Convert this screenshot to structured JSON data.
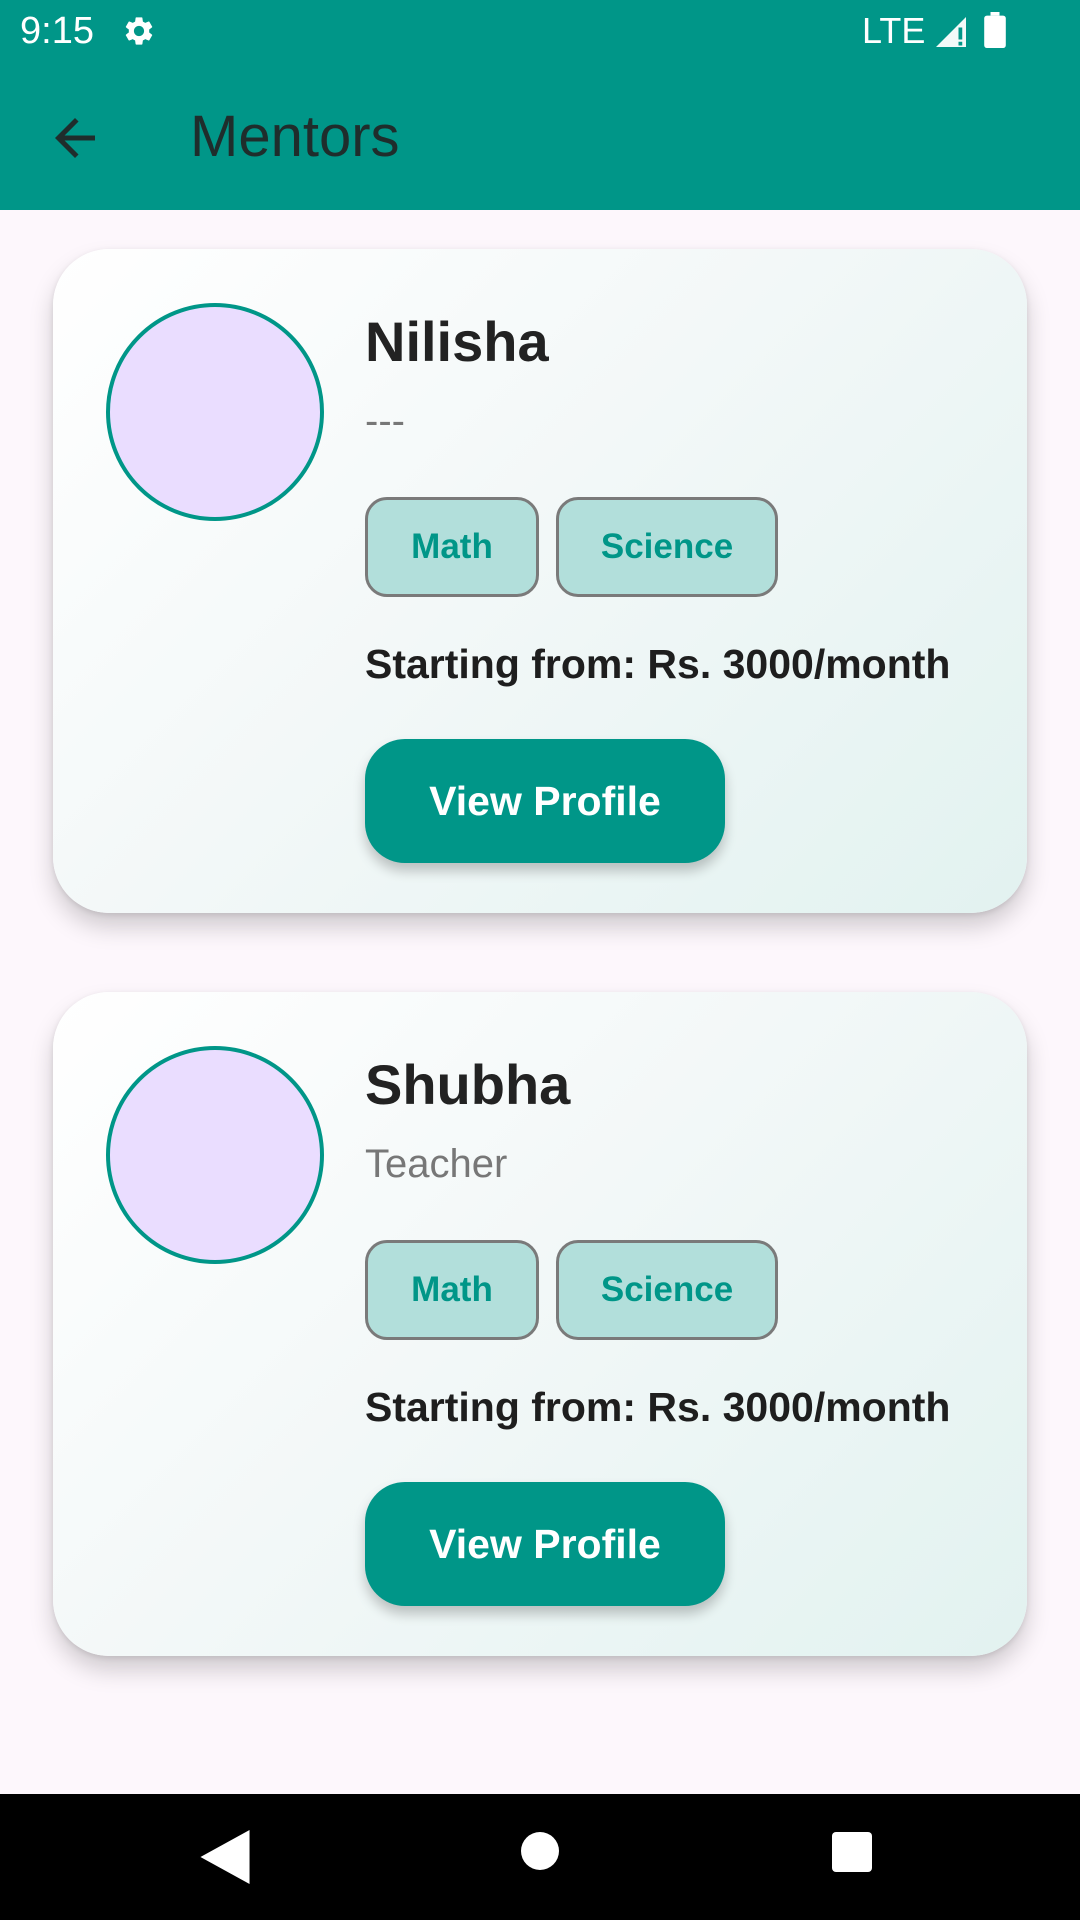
{
  "status_bar": {
    "time": "9:15",
    "network": "LTE",
    "icons": [
      "gear-icon",
      "signal-icon",
      "battery-icon"
    ]
  },
  "app_bar": {
    "title": "Mentors",
    "back_icon": "arrow-left-icon"
  },
  "mentors": [
    {
      "name": "Nilisha",
      "role": "---",
      "subjects": [
        "Math",
        "Science"
      ],
      "price": "Starting from: Rs. 3000/month",
      "button_label": "View Profile"
    },
    {
      "name": "Shubha",
      "role": "Teacher",
      "subjects": [
        "Math",
        "Science"
      ],
      "price": "Starting from: Rs. 3000/month",
      "button_label": "View Profile"
    }
  ],
  "nav_bar": {
    "icons": [
      "nav-back-icon",
      "nav-home-icon",
      "nav-recents-icon"
    ]
  },
  "colors": {
    "primary": "#009688",
    "chip_background": "#B2DFDB",
    "avatar_fill": "#EADDFF",
    "page_background": "#FDF7FC"
  }
}
